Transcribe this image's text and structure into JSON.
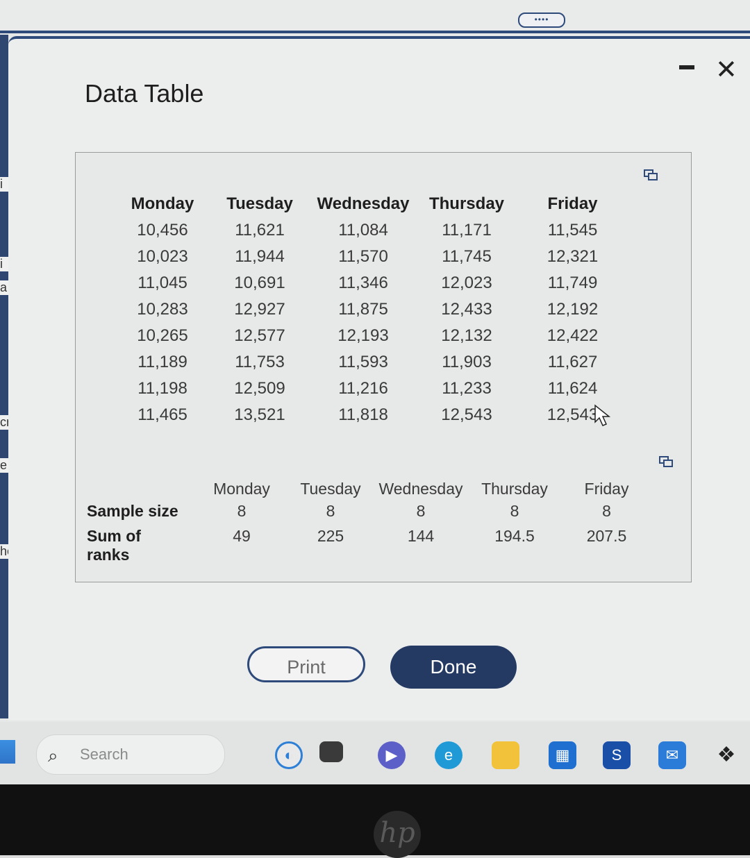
{
  "window": {
    "title": "Data Table",
    "minimize_symbol": "–",
    "close_symbol": "✕"
  },
  "data_table": {
    "headers": [
      "Monday",
      "Tuesday",
      "Wednesday",
      "Thursday",
      "Friday"
    ],
    "rows": [
      [
        "10,456",
        "11,621",
        "11,084",
        "11,171",
        "11,545"
      ],
      [
        "10,023",
        "11,944",
        "11,570",
        "11,745",
        "12,321"
      ],
      [
        "11,045",
        "10,691",
        "11,346",
        "12,023",
        "11,749"
      ],
      [
        "10,283",
        "12,927",
        "11,875",
        "12,433",
        "12,192"
      ],
      [
        "10,265",
        "12,577",
        "12,193",
        "12,132",
        "12,422"
      ],
      [
        "11,189",
        "11,753",
        "11,593",
        "11,903",
        "11,627"
      ],
      [
        "11,198",
        "12,509",
        "11,216",
        "11,233",
        "11,624"
      ],
      [
        "11,465",
        "13,521",
        "11,818",
        "12,543",
        "12,543"
      ]
    ]
  },
  "summary_table": {
    "headers": [
      "Monday",
      "Tuesday",
      "Wednesday",
      "Thursday",
      "Friday"
    ],
    "rows": [
      {
        "label": "Sample size",
        "values": [
          "8",
          "8",
          "8",
          "8",
          "8"
        ]
      },
      {
        "label": "Sum of ranks",
        "values": [
          "49",
          "225",
          "144",
          "194.5",
          "207.5"
        ]
      }
    ]
  },
  "buttons": {
    "print": "Print",
    "done": "Done"
  },
  "taskbar": {
    "search_placeholder": "Search"
  },
  "branding": {
    "laptop_logo": "hp"
  },
  "colors": {
    "accent": "#2d4a7a",
    "done_button": "#243a63"
  }
}
